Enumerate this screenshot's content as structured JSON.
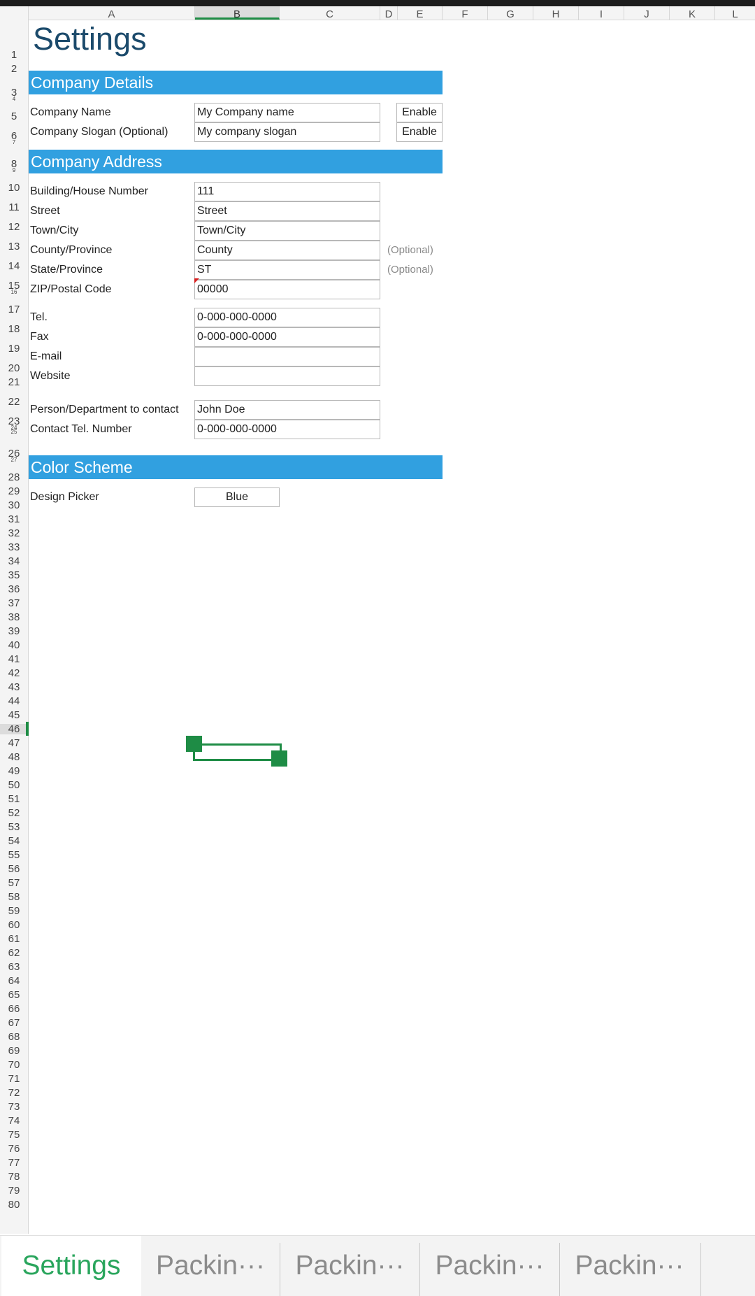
{
  "columns": [
    "A",
    "B",
    "C",
    "D",
    "E",
    "F",
    "G",
    "H",
    "I",
    "J",
    "K",
    "L"
  ],
  "selected_column": "B",
  "row_numbers": [
    "1",
    "2",
    "3",
    "4",
    "5",
    "6",
    "7",
    "8",
    "9",
    "10",
    "11",
    "12",
    "13",
    "14",
    "15",
    "16",
    "17",
    "18",
    "19",
    "20",
    "21",
    "22",
    "23",
    "24",
    "25",
    "26",
    "27",
    "28",
    "29",
    "30",
    "31",
    "32",
    "33",
    "34",
    "35",
    "36",
    "37",
    "38",
    "39",
    "40",
    "41",
    "42",
    "43",
    "44",
    "45",
    "46",
    "47",
    "48",
    "49",
    "50",
    "51",
    "52",
    "53",
    "54",
    "55",
    "56",
    "57",
    "58",
    "59",
    "60",
    "61",
    "62",
    "63",
    "64",
    "65",
    "66",
    "67",
    "68",
    "69",
    "70",
    "71",
    "72",
    "73",
    "74",
    "75",
    "76",
    "77",
    "78",
    "79",
    "80"
  ],
  "selected_row": "46",
  "title": "Settings",
  "sections": {
    "company_details": "Company Details",
    "company_address": "Company Address",
    "color_scheme": "Color Scheme"
  },
  "company": {
    "name_label": "Company Name",
    "name_value": "My Company name",
    "name_toggle": "Enable",
    "slogan_label": "Company Slogan (Optional)",
    "slogan_value": "My company slogan",
    "slogan_toggle": "Enable"
  },
  "address": {
    "building_label": "Building/House Number",
    "building_value": "111",
    "street_label": "Street",
    "street_value": "Street",
    "town_label": "Town/City",
    "town_value": "Town/City",
    "county_label": "County/Province",
    "county_value": "County",
    "county_note": "(Optional)",
    "state_label": "State/Province",
    "state_value": "ST",
    "state_note": "(Optional)",
    "zip_label": "ZIP/Postal Code",
    "zip_value": "00000"
  },
  "contact": {
    "tel_label": "Tel.",
    "tel_value": "0-000-000-0000",
    "fax_label": "Fax",
    "fax_value": "0-000-000-0000",
    "email_label": "E-mail",
    "email_value": "",
    "website_label": "Website",
    "website_value": "",
    "person_label": "Person/Department to contact",
    "person_value": "John Doe",
    "contact_tel_label": "Contact Tel. Number",
    "contact_tel_value": "0-000-000-0000"
  },
  "color_scheme": {
    "picker_label": "Design Picker",
    "picker_value": "Blue"
  },
  "sheet_tabs": [
    "Settings",
    "Packin···",
    "Packin···",
    "Packin···",
    "Packin···"
  ],
  "active_tab": "Settings",
  "colors": {
    "section_bg": "#31a0e0",
    "title_color": "#1b4a6b",
    "selection": "#1e8c45",
    "active_tab": "#29a55c"
  }
}
